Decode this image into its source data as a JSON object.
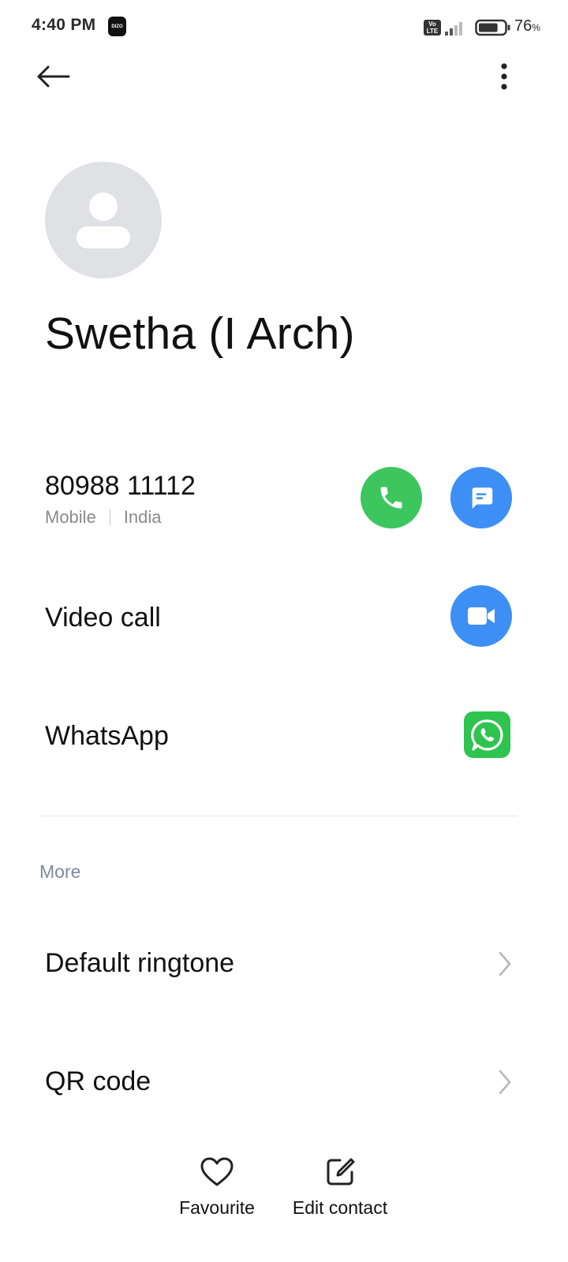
{
  "status_bar": {
    "time": "4:40 PM",
    "badge": "DIZO",
    "volte": "Vo LTE",
    "battery_percent": "76",
    "battery_unit": "%",
    "battery_level": 0.76
  },
  "header": {
    "back_icon": "arrow-left-icon",
    "more_icon": "more-vertical-icon"
  },
  "contact": {
    "name": "Swetha (I Arch)",
    "avatar_icon": "person-placeholder-icon",
    "phone": {
      "number": "80988 11112",
      "type": "Mobile",
      "region": "India"
    }
  },
  "actions": {
    "video_call_label": "Video call",
    "whatsapp_label": "WhatsApp"
  },
  "more_section": {
    "header": "More",
    "items": [
      {
        "label": "Default ringtone"
      },
      {
        "label": "QR code"
      }
    ]
  },
  "bottom_bar": {
    "favourite_label": "Favourite",
    "edit_label": "Edit contact"
  },
  "colors": {
    "call_green": "#3ec65e",
    "accent_blue": "#3d8ff5",
    "whatsapp_green": "#2fc34f",
    "avatar_grey": "#dfe1e5",
    "section_header": "#7e8aa6"
  }
}
